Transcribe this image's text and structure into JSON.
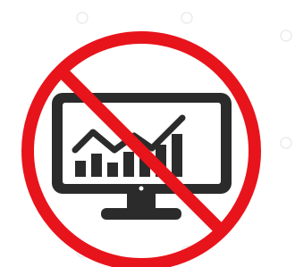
{
  "icon": {
    "name": "no-monitoring-prohibition-sign",
    "depicts": "monitor-with-chart-icon"
  },
  "colors": {
    "prohibition_red": "#e8141b",
    "icon_dark": "#2b2b2b",
    "background": "#ffffff",
    "watermark": "#ececec"
  }
}
